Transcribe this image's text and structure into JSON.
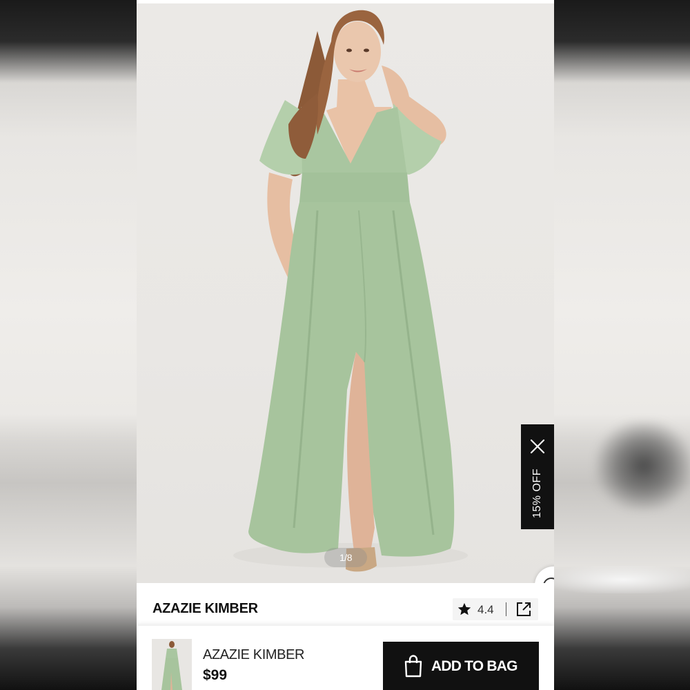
{
  "gallery": {
    "pager": "1/8"
  },
  "promo": {
    "label": "15% OFF",
    "close_icon": "close-icon"
  },
  "product": {
    "title": "AZAZIE KIMBER",
    "rating": "4.4",
    "rating_icon": "star-icon",
    "share_icon": "external-link-icon"
  },
  "chat": {
    "icon": "chat-bubble-icon"
  },
  "bottom_bar": {
    "name": "AZAZIE KIMBER",
    "price": "$99",
    "add_to_bag_label": "ADD TO BAG",
    "bag_icon": "shopping-bag-icon"
  },
  "colors": {
    "dress": "#a7c49d",
    "background": "#ebe9e6",
    "button": "#111111"
  }
}
